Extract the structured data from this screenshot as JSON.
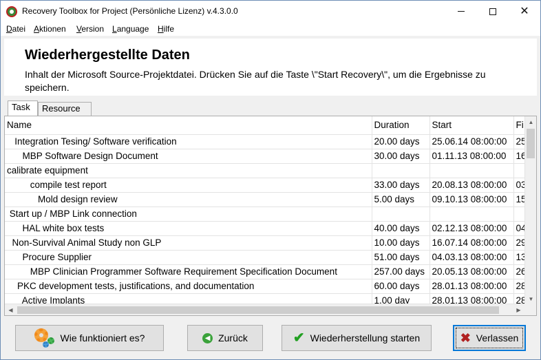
{
  "window": {
    "title": "Recovery Toolbox for Project (Persönliche Lizenz) v.4.3.0.0"
  },
  "menu": {
    "file": "Datei",
    "actions": "Aktionen",
    "version": "Version",
    "language": "Language",
    "help": "Hilfe"
  },
  "header": {
    "title": "Wiederhergestellte Daten",
    "description": "Inhalt der Microsoft Source-Projektdatei. Drücken Sie auf die Taste \\\"Start Recovery\\\", um die Ergebnisse zu speichern."
  },
  "tabs": [
    {
      "label": "Task",
      "active": true
    },
    {
      "label": "Resource",
      "active": false
    }
  ],
  "table": {
    "columns": [
      "Name",
      "Duration",
      "Start",
      "Fi"
    ],
    "rows": [
      {
        "name": "   Integration Tesing/ Software verification",
        "duration": "20.00 days",
        "start": "25.06.14 08:00:00",
        "finish": "25"
      },
      {
        "name": "      MBP Software Design Document",
        "duration": "30.00 days",
        "start": "01.11.13 08:00:00",
        "finish": "16"
      },
      {
        "name": "calibrate equipment",
        "duration": "",
        "start": "",
        "finish": ""
      },
      {
        "name": "         compile test report",
        "duration": "33.00 days",
        "start": "20.08.13 08:00:00",
        "finish": "03"
      },
      {
        "name": "            Mold design review",
        "duration": "5.00 days",
        "start": "09.10.13 08:00:00",
        "finish": "15"
      },
      {
        "name": " Start up / MBP Link connection",
        "duration": "",
        "start": "",
        "finish": ""
      },
      {
        "name": "      HAL white box tests",
        "duration": "40.00 days",
        "start": "02.12.13 08:00:00",
        "finish": "04"
      },
      {
        "name": "  Non-Survival Animal Study non GLP",
        "duration": "10.00 days",
        "start": "16.07.14 08:00:00",
        "finish": "29"
      },
      {
        "name": "      Procure Supplier",
        "duration": "51.00 days",
        "start": "04.03.13 08:00:00",
        "finish": "13"
      },
      {
        "name": "         MBP Clinician Programmer Software Requirement Specification Document",
        "duration": "257.00 days",
        "start": "20.05.13 08:00:00",
        "finish": "26"
      },
      {
        "name": "    PKC development tests, justifications, and documentation",
        "duration": "60.00 days",
        "start": "28.01.13 08:00:00",
        "finish": "28"
      },
      {
        "name": "      Active Implants",
        "duration": "1.00 day",
        "start": "28.01.13 08:00:00",
        "finish": "28"
      }
    ]
  },
  "buttons": {
    "help": "Wie funktioniert es?",
    "back": "Zurück",
    "start": "Wiederherstellung starten",
    "exit": "Verlassen"
  }
}
